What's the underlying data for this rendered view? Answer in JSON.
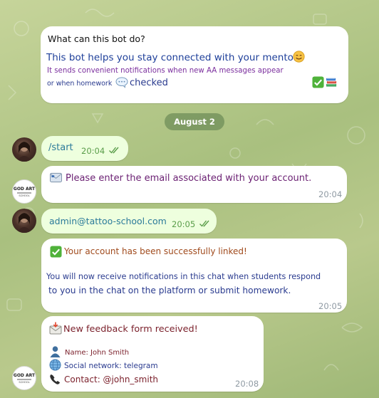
{
  "intro": {
    "title": "What can this bot do?",
    "line1": "This bot helps you stay connected with your mentor",
    "line2": "It sends convenient notifications when new AA messages appear",
    "line3_pre": "or when homework",
    "line3_post": "checked"
  },
  "date_separator": "August 2",
  "messages": {
    "start": {
      "text": "/start",
      "time": "20:04"
    },
    "email_prompt": {
      "text": "Please enter the email associated with your account.",
      "time": "20:04"
    },
    "email_reply": {
      "text": "admin@tattoo-school.com",
      "time": "20:05"
    },
    "linked": {
      "line1": "Your account has been successfully linked!",
      "line2": "You will now receive notifications in this chat when students respond",
      "line3": "to you in the chat on the platform or submit homework.",
      "time": "20:05"
    },
    "feedback": {
      "title": "New feedback form received!",
      "name": "Name: John Smith",
      "network": "Social network: telegram",
      "contact": "Contact: @john_smith",
      "time": "20:08"
    }
  },
  "icons": {
    "smile": "smile-emoji",
    "speech": "speech-balloon-emoji",
    "check": "check-mark-button-emoji",
    "books": "books-emoji",
    "email": "email-emoji",
    "envelope": "envelope-arrow-emoji",
    "person": "bust-silhouette-emoji",
    "globe": "globe-meridians-emoji",
    "phone": "telephone-receiver-emoji"
  },
  "colors": {
    "intro_blue": "#1e3f9a",
    "intro_purple": "#7b2f9e",
    "bot_text": "#6a1f72",
    "notice_orange": "#a04a1c",
    "info_blue": "#2a3b8f",
    "feedback_text": "#7a1f2a",
    "outgoing_text": "#2b7a9a",
    "background": "#b5c98a"
  }
}
